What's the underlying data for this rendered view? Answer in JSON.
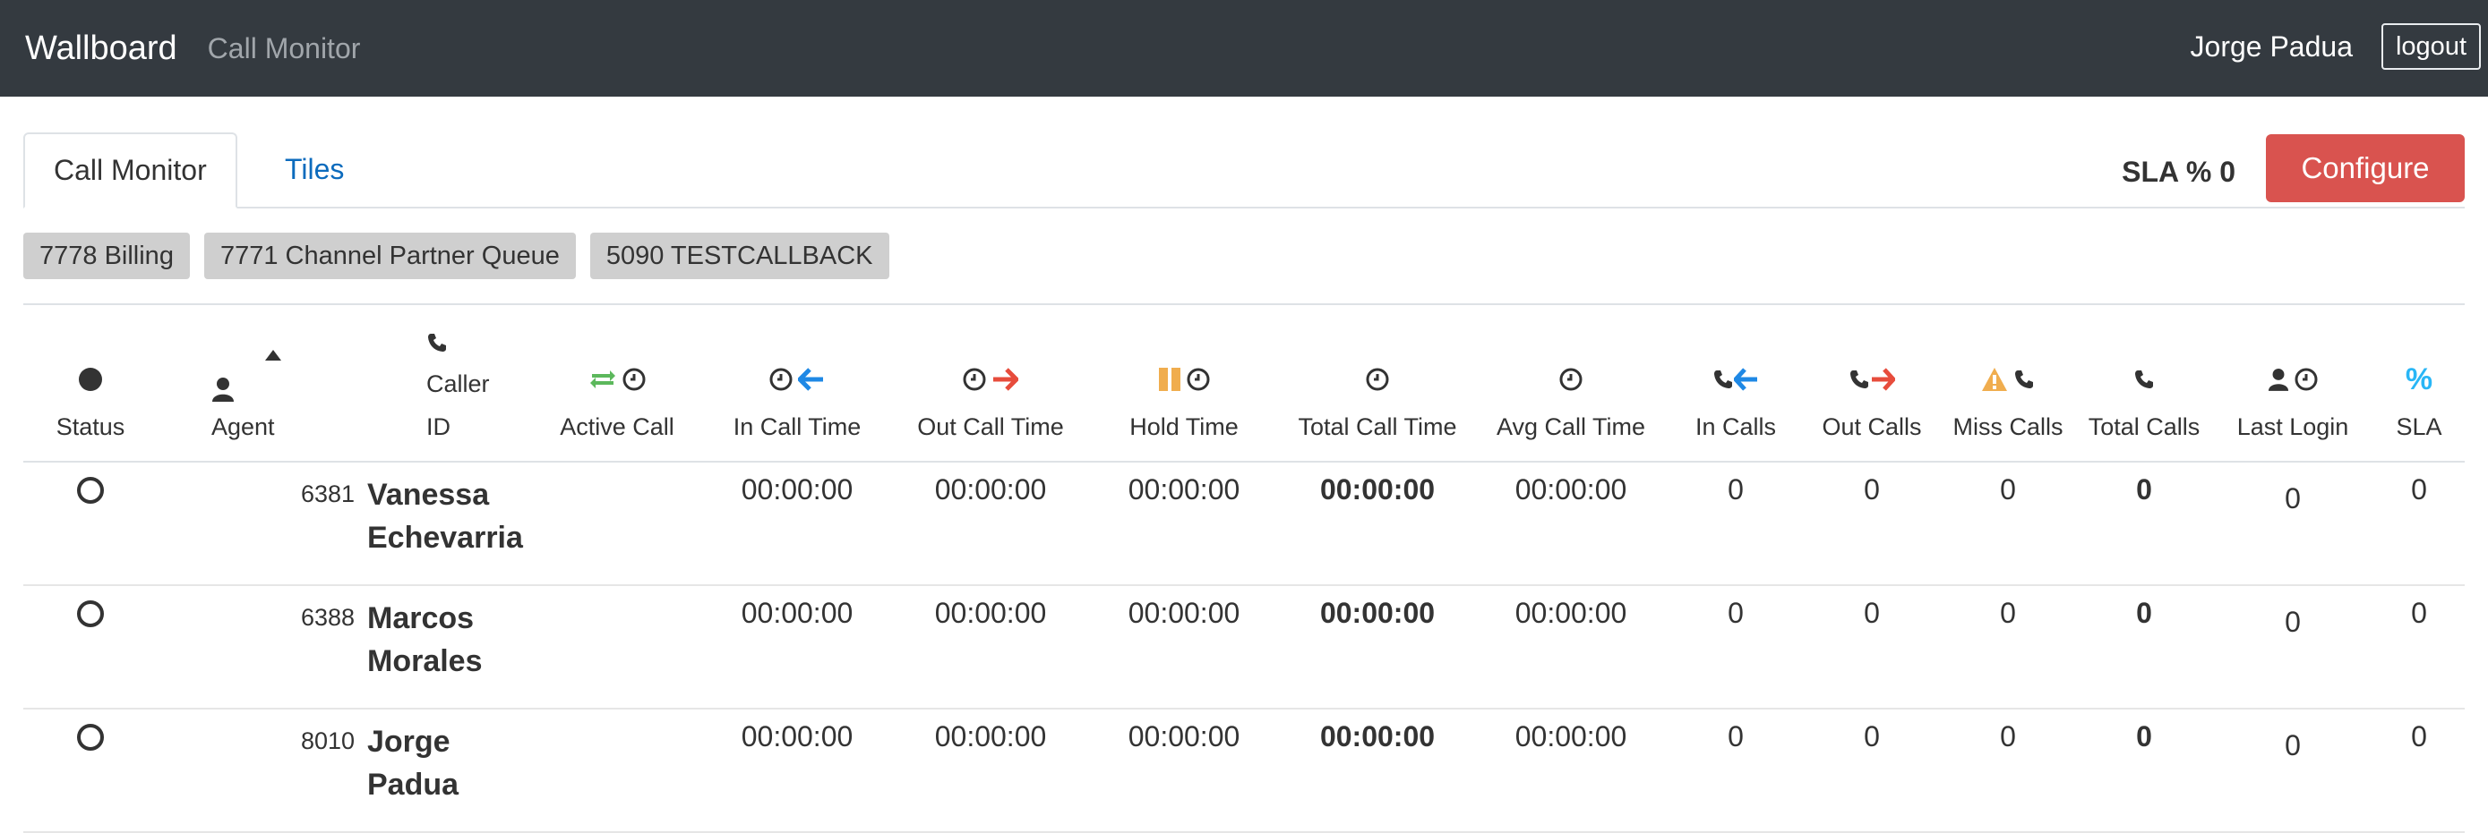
{
  "navbar": {
    "brand": "Wallboard",
    "nav_link": "Call Monitor",
    "user": "Jorge Padua",
    "logout_label": "logout"
  },
  "tabs": [
    {
      "label": "Call Monitor",
      "active": true
    },
    {
      "label": "Tiles",
      "active": false
    }
  ],
  "sla_label": "SLA % 0",
  "configure_label": "Configure",
  "queues": [
    "7778 Billing",
    "7771 Channel Partner Queue",
    "5090 TESTCALLBACK"
  ],
  "colors": {
    "navbar_bg": "#343a40",
    "configure_bg": "#d9534f",
    "link_blue": "#0c6bbd",
    "green": "#5cb85c",
    "blue": "#1e88e5",
    "red": "#e74c3c",
    "orange": "#f0ad4e",
    "cyan": "#29b6f6"
  },
  "columns": {
    "status": "Status",
    "agent": "Agent",
    "caller_id_1": "Caller",
    "caller_id_2": "ID",
    "active_call": "Active Call",
    "in_call_time": "In Call Time",
    "out_call_time": "Out Call Time",
    "hold_time": "Hold Time",
    "total_call_time": "Total Call Time",
    "avg_call_time": "Avg Call Time",
    "in_calls": "In Calls",
    "out_calls": "Out Calls",
    "miss_calls": "Miss Calls",
    "total_calls": "Total Calls",
    "last_login": "Last Login",
    "sla": "SLA"
  },
  "rows": [
    {
      "ext": "6381",
      "name": "Vanessa Echevarria",
      "in_call_time": "00:00:00",
      "out_call_time": "00:00:00",
      "hold_time": "00:00:00",
      "total_call_time": "00:00:00",
      "avg_call_time": "00:00:00",
      "in_calls": "0",
      "out_calls": "0",
      "miss_calls": "0",
      "total_calls": "0",
      "last_login": "0",
      "sla": "0"
    },
    {
      "ext": "6388",
      "name": "Marcos Morales",
      "in_call_time": "00:00:00",
      "out_call_time": "00:00:00",
      "hold_time": "00:00:00",
      "total_call_time": "00:00:00",
      "avg_call_time": "00:00:00",
      "in_calls": "0",
      "out_calls": "0",
      "miss_calls": "0",
      "total_calls": "0",
      "last_login": "0",
      "sla": "0"
    },
    {
      "ext": "8010",
      "name": "Jorge Padua",
      "in_call_time": "00:00:00",
      "out_call_time": "00:00:00",
      "hold_time": "00:00:00",
      "total_call_time": "00:00:00",
      "avg_call_time": "00:00:00",
      "in_calls": "0",
      "out_calls": "0",
      "miss_calls": "0",
      "total_calls": "0",
      "last_login": "0",
      "sla": "0"
    }
  ]
}
